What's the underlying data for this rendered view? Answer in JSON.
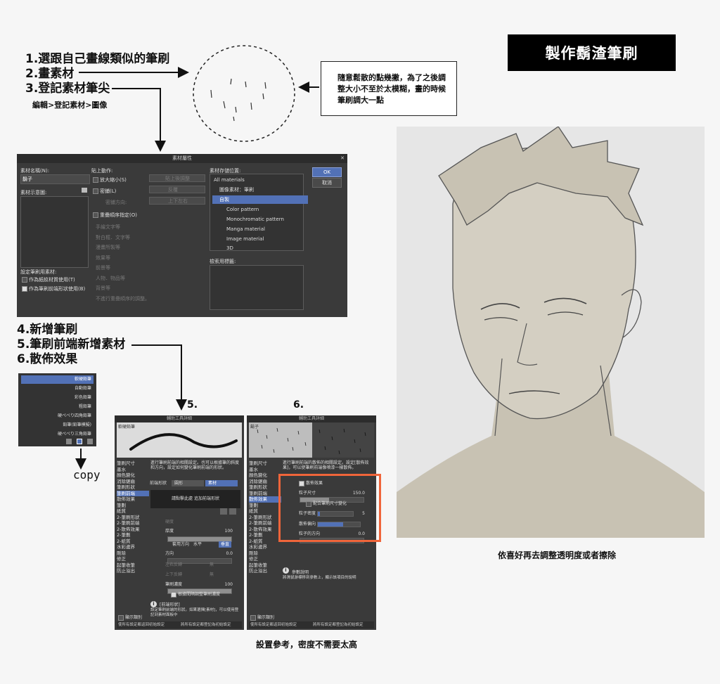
{
  "title": "製作鬍渣筆刷",
  "steps": {
    "s1": "1.選跟自己畫線類似的筆刷",
    "s2": "2.畫素材",
    "s3": "3.登記素材筆尖",
    "s3_path": "編輯>登記素材>圖像",
    "s4": "4.新增筆刷",
    "s5": "5.筆刷前端新增素材",
    "s6": "6.散佈效果"
  },
  "note": "隨意鬆散的點幾撇，為了之後調整大小不至於太模糊，畫的時候筆刷調大一點",
  "label_copy": "copy",
  "label_5": "5.",
  "label_6": "6.",
  "caption_settings": "設置參考，密度不需要太高",
  "caption_portrait": "依喜好再去調整透明度或者擦除",
  "dialog": {
    "title": "素材屬性",
    "close": "✕",
    "name_label": "素材名稱(N):",
    "name_value": "鬍子",
    "image_label": "素材示意圖:",
    "paste_label": "貼上動作:",
    "opt_enlarge": "放大縮小(S)",
    "opt_enlarge_val": "貼上後調整",
    "opt_tile": "密鋪(L)",
    "opt_tile_val": "反覆",
    "opt_tile_dir_label": "密鋪方向:",
    "opt_tile_dir_val": "上下左右",
    "layer_order": "重疊順序指定(O)",
    "radio_items": [
      "手繪文字等",
      "對白框．文字等",
      "漫畫所製等",
      "效果等",
      "前景等",
      "人物．物品等",
      "背景等"
    ],
    "radio_note": "不進行重疊順序的調整。",
    "brush_tip_label": "設定筆刷用素材:",
    "brush_tip_1": "作為紙紋材質使用(T)",
    "brush_tip_2": "作為筆刷前端形狀使用(B)",
    "location_label": "素材存儲位置:",
    "tree": [
      "All materials",
      "圖像素材：筆刷",
      "自製",
      "Color pattern",
      "Monochromatic pattern",
      "Manga material",
      "Image material",
      "3D"
    ],
    "tag_label": "檢索用標籤:",
    "ok": "OK",
    "cancel": "取消"
  },
  "brush_list": [
    "軟硬鉛筆",
    "自動鉛筆",
    "彩色鉛筆",
    "粗鉛筆",
    "硬ぺべり四角鉛筆",
    "鉛筆(鉛筆模擬)",
    "硬ぺべり三角鉛筆"
  ],
  "panel_left": {
    "title": "輔助工具詳細",
    "preview_label": "軟硬鉛筆",
    "categories": [
      "筆刷尺寸",
      "墨水",
      "顏色變化",
      "消除鋸齒",
      "筆刷形狀",
      "筆刷前端",
      "散佈效果",
      "筆劃",
      "紙質",
      "2-筆刷形狀",
      "2-筆刷前端",
      "2-散佈效果",
      "2-筆劃",
      "2-紙質",
      "水彩邊界",
      "剛除",
      "修正",
      "起筆收筆",
      "防止溢出"
    ],
    "desc": "進行筆刷前端的相關設定。也可以根據筆的斜度和方向，設定如何變化筆刷前端的形狀。",
    "shape_label": "前端形狀",
    "shape_round": "圓形",
    "shape_material": "素材",
    "drop_hint": "請點擊此處 追加前端形狀",
    "hardness": "硬度",
    "thickness": "厚度",
    "thickness_val": "100",
    "apply_dir": "套用方向",
    "horizontal": "水平",
    "vertical": "垂直",
    "direction": "方向",
    "direction_val": "0.0",
    "flip_lr": "左右反轉",
    "flip_ud": "上下反轉",
    "none": "無",
    "density": "筆刷濃度",
    "density_val": "100",
    "adjust_density": "根據間隔調整筆刷濃度",
    "info_title": "[前端形狀]",
    "info_text": "設定筆刷前端的形狀。如果選擇[素材]，可以使用登記到素材面板中",
    "show_category": "顯示類別",
    "btn_reset": "使所有設定都返回初始設定",
    "btn_save": "將所有設定都登記為初始設定"
  },
  "panel_right": {
    "title": "輔助工具詳細",
    "preview_label": "鬍子",
    "categories": [
      "筆刷尺寸",
      "墨水",
      "顏色變化",
      "消除鋸齒",
      "筆刷形狀",
      "筆刷前端",
      "散佈效果",
      "筆劃",
      "紙質",
      "2-筆刷形狀",
      "2-筆刷前端",
      "2-散佈效果",
      "2-筆劃",
      "2-紙質",
      "水彩邊界",
      "剛除",
      "修正",
      "起筆收筆",
      "防止溢出"
    ],
    "desc": "進行筆刷前端的散佈的相關設定。設定[散佈效果]，可以使筆刷前端像噴漆一樣散佈。",
    "scatter": "散佈效果",
    "particle_size": "粒子尺寸",
    "particle_size_val": "150.0",
    "match_size": "配合筆刷尺寸變化",
    "particle_density": "粒子密度",
    "particle_density_val": "5",
    "scatter_bias": "散佈偏向",
    "particle_direction": "粒子的方向",
    "particle_direction_val": "0.0",
    "info_title": "參數說明",
    "info_text": "將滑鼠游標移到參數上，顯示該項目的說明",
    "show_category": "顯示類別",
    "btn_reset": "使所有設定都返回初始設定",
    "btn_save": "將所有設定都登記為初始設定"
  },
  "colors": {
    "accent": "#5271b6",
    "highlight": "#f0653a",
    "panel": "#3a3a3a"
  }
}
